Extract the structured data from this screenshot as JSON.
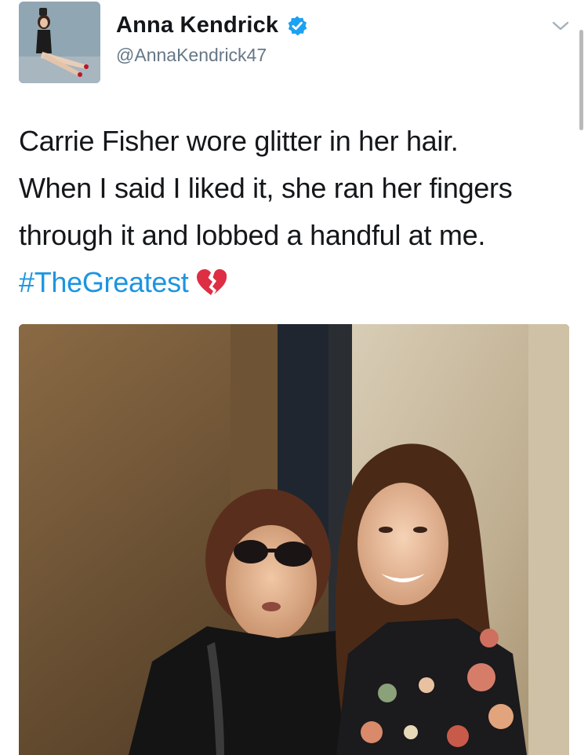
{
  "tweet": {
    "author": {
      "display_name": "Anna Kendrick",
      "handle": "@AnnaKendrick47",
      "verified": true,
      "avatar_icon": "profile-photo"
    },
    "text_lines": [
      "Carrie Fisher wore glitter in her hair.",
      "When I said I liked it, she ran her fingers",
      "through it and lobbed a handful at me."
    ],
    "hashtag": "#TheGreatest",
    "emoji_icon": "broken-heart-icon",
    "menu_icon": "chevron-down-icon",
    "media": {
      "type": "photo"
    }
  },
  "colors": {
    "hashtag": "#1b95e0",
    "verified_badge": "#1da1f2",
    "handle": "#657786",
    "text": "#14171a",
    "broken_heart": "#dd2e44"
  }
}
